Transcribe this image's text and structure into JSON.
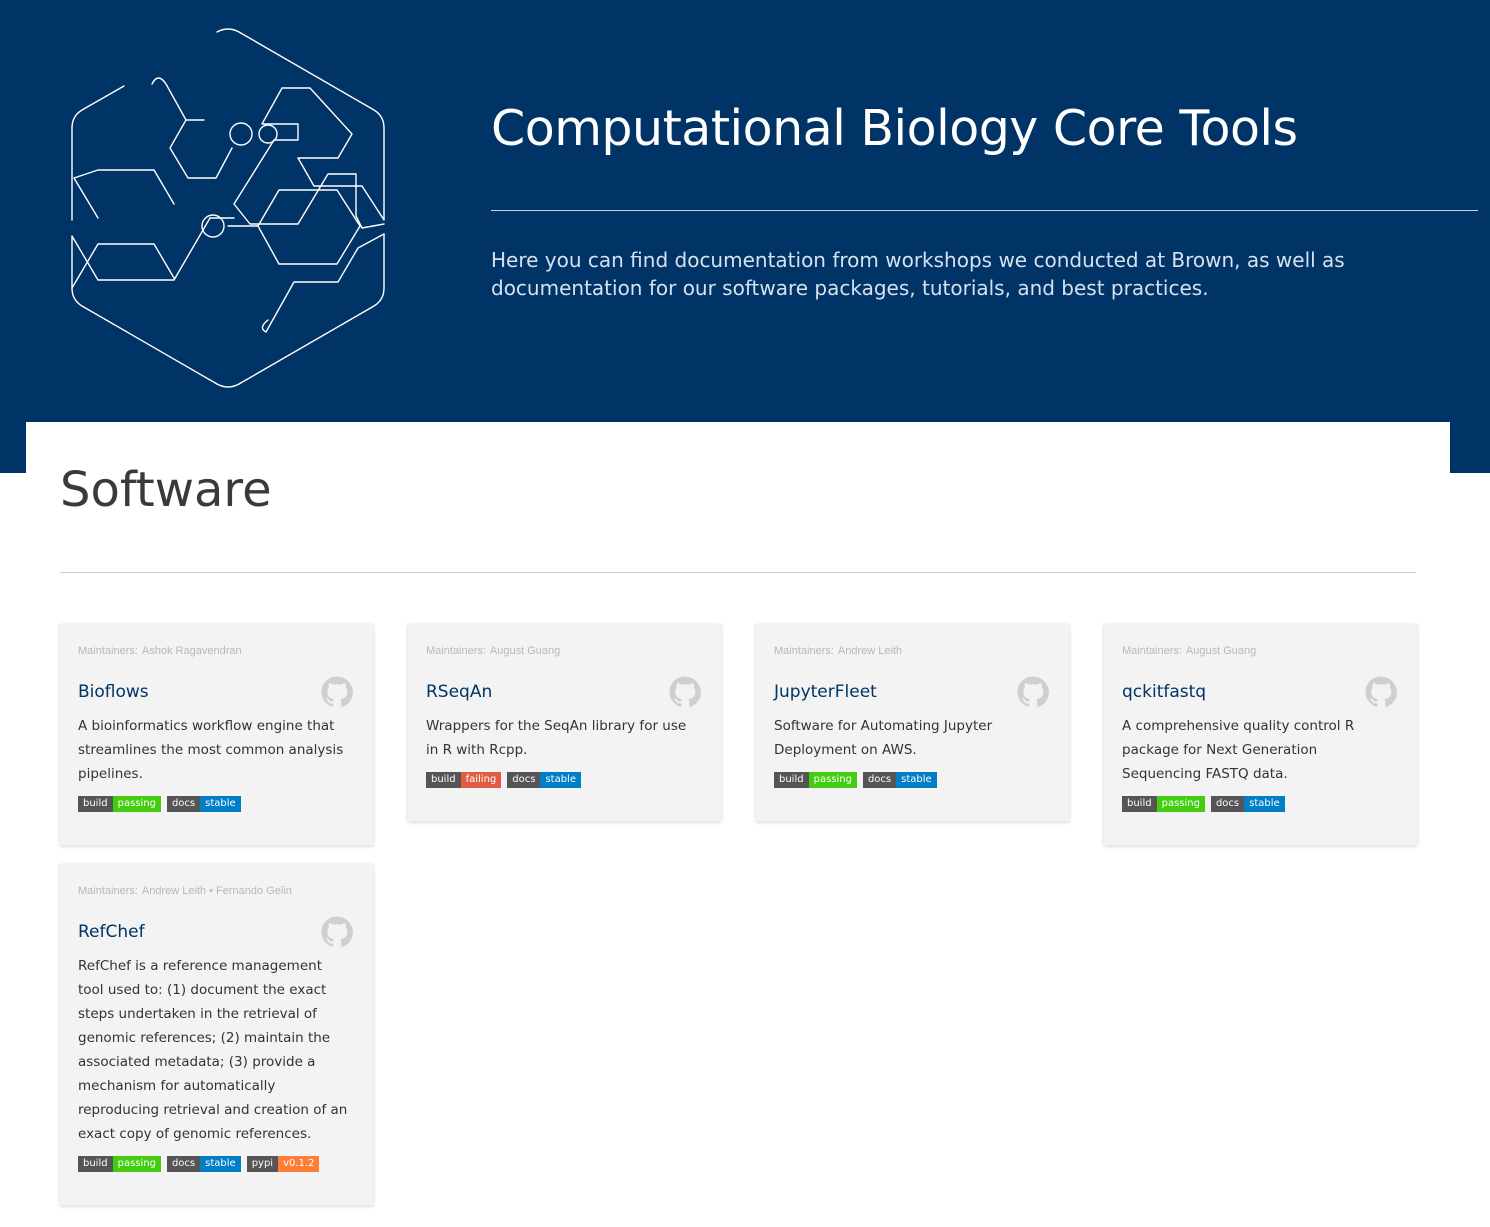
{
  "hero": {
    "title": "Computational Biology Core Tools",
    "description": "Here you can find documentation from workshops we conducted at Brown, as well as documentation for our software packages, tutorials, and best practices."
  },
  "section": {
    "title": "Software"
  },
  "labels": {
    "maintainers": "Maintainers:",
    "separator": "•"
  },
  "colors": {
    "hero_bg": "#003366",
    "badge_label": "#555555",
    "passing": "#44cc11",
    "failing": "#e05d44",
    "stable": "#007ec6",
    "version": "#fe7d37"
  },
  "cards": [
    {
      "maintainers": [
        "Ashok Ragavendran"
      ],
      "title": "Bioflows",
      "description": "A bioinformatics workflow engine that streamlines the most common analysis pipelines.",
      "icon": "github-icon",
      "badges": [
        {
          "label": "build",
          "value": "passing",
          "color": "#44cc11"
        },
        {
          "label": "docs",
          "value": "stable",
          "color": "#007ec6"
        }
      ]
    },
    {
      "maintainers": [
        "August Guang"
      ],
      "title": "RSeqAn",
      "description": "Wrappers for the SeqAn library for use in R with Rcpp.",
      "icon": "github-icon",
      "badges": [
        {
          "label": "build",
          "value": "failing",
          "color": "#e05d44"
        },
        {
          "label": "docs",
          "value": "stable",
          "color": "#007ec6"
        }
      ]
    },
    {
      "maintainers": [
        "Andrew Leith"
      ],
      "title": "JupyterFleet",
      "description": "Software for Automating Jupyter Deployment on AWS.",
      "icon": "github-icon",
      "badges": [
        {
          "label": "build",
          "value": "passing",
          "color": "#44cc11"
        },
        {
          "label": "docs",
          "value": "stable",
          "color": "#007ec6"
        }
      ]
    },
    {
      "maintainers": [
        "August Guang"
      ],
      "title": "qckitfastq",
      "description": "A comprehensive quality control R package for Next Generation Sequencing FASTQ data.",
      "icon": "github-icon",
      "badges": [
        {
          "label": "build",
          "value": "passing",
          "color": "#44cc11"
        },
        {
          "label": "docs",
          "value": "stable",
          "color": "#007ec6"
        }
      ]
    },
    {
      "maintainers": [
        "Andrew Leith",
        "Fernando Gelin"
      ],
      "title": "RefChef",
      "description": "RefChef is a reference management tool used to: (1) document the exact steps undertaken in the retrieval of genomic references; (2) maintain the associated metadata; (3) provide a mechanism for automatically reproducing retrieval and creation of an exact copy of genomic references.",
      "icon": "github-icon",
      "badges": [
        {
          "label": "build",
          "value": "passing",
          "color": "#44cc11"
        },
        {
          "label": "docs",
          "value": "stable",
          "color": "#007ec6"
        },
        {
          "label": "pypi",
          "value": "v0.1.2",
          "color": "#fe7d37"
        }
      ]
    }
  ]
}
